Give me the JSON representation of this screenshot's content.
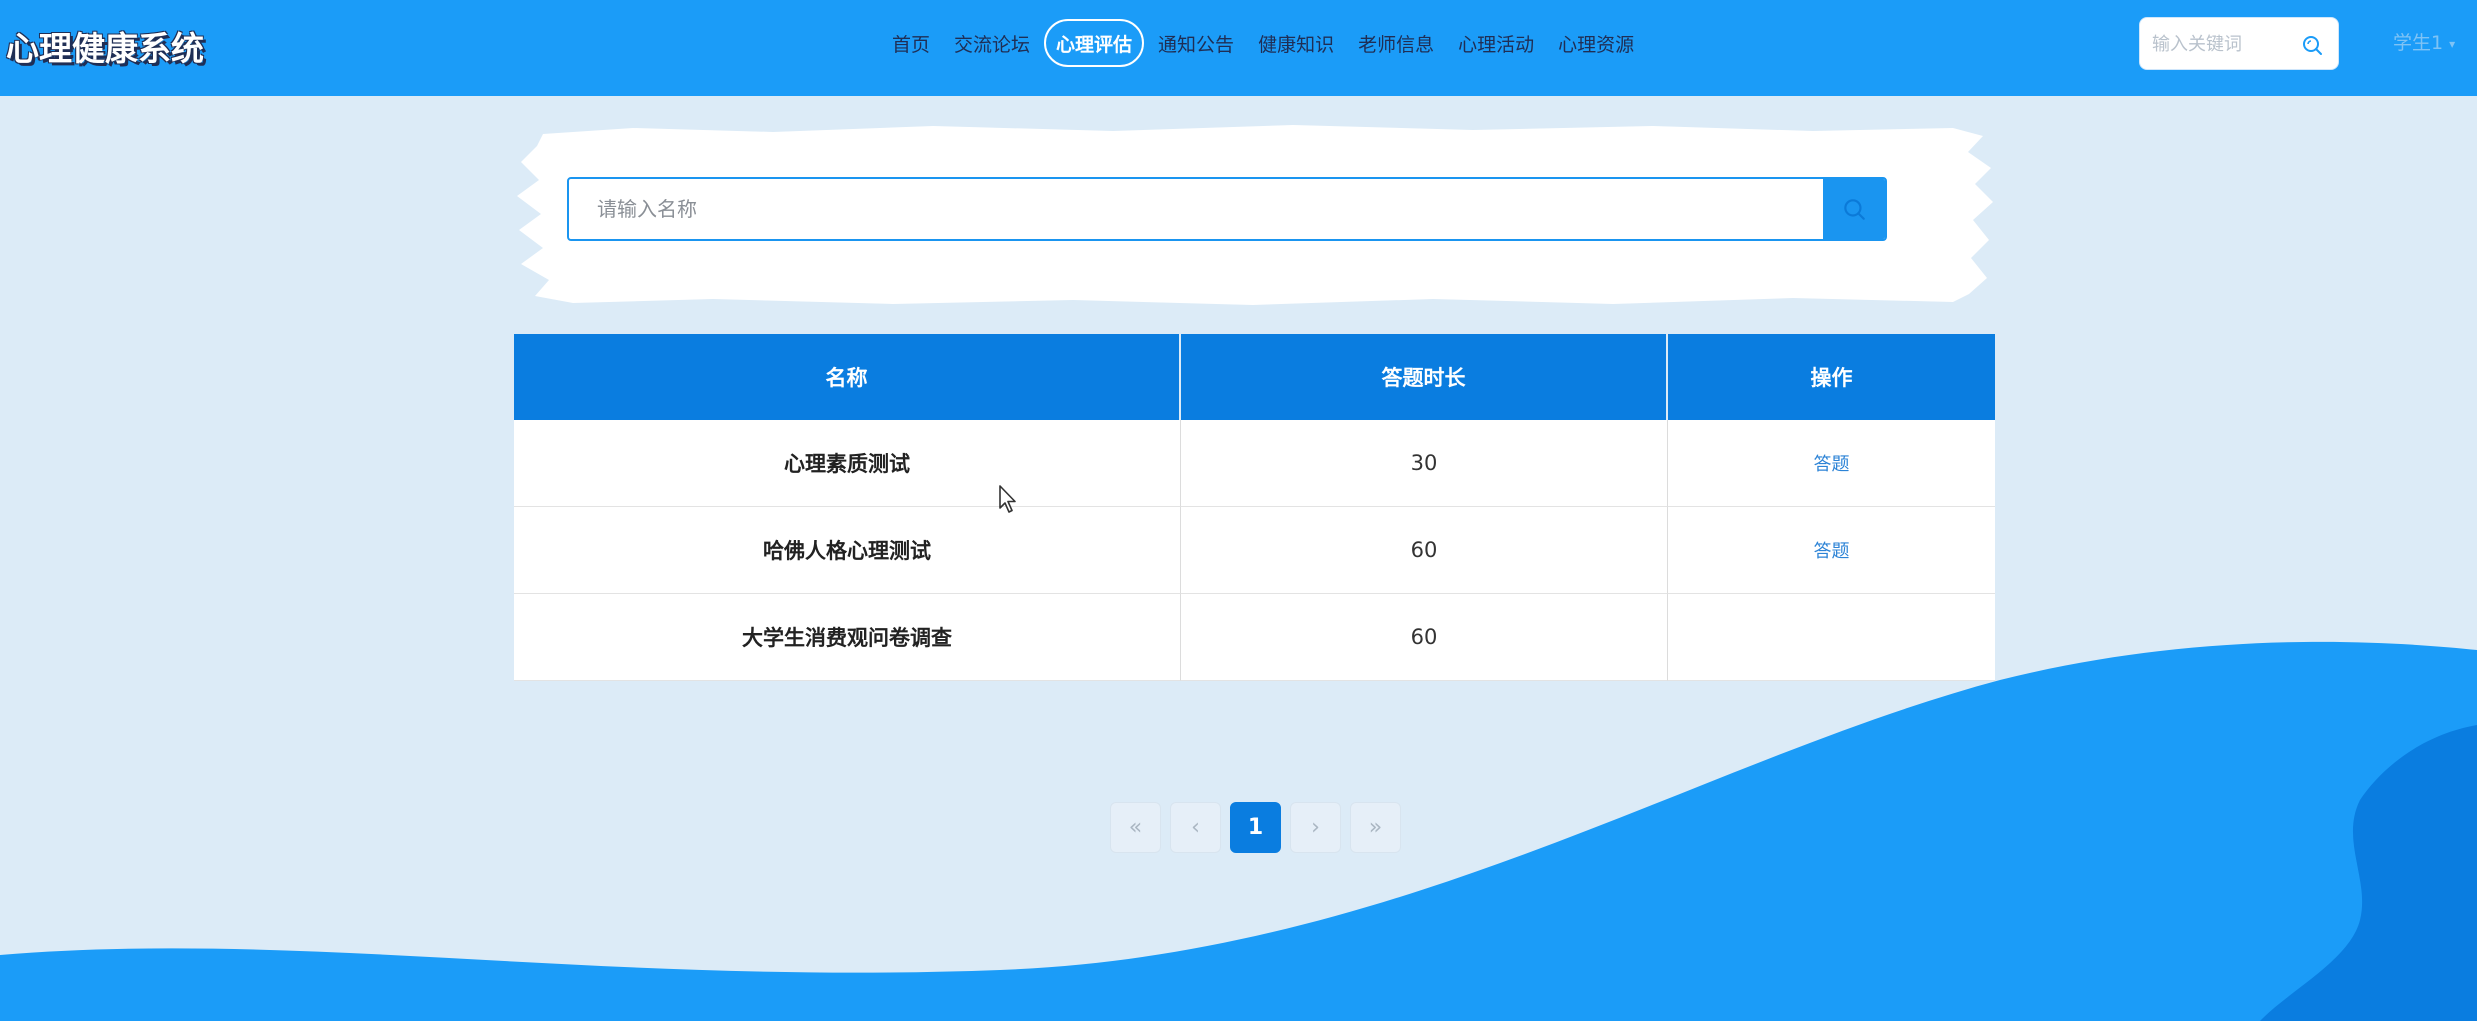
{
  "header": {
    "site_title": "心理健康系统",
    "nav": [
      {
        "label": "首页",
        "active": false
      },
      {
        "label": "交流论坛",
        "active": false
      },
      {
        "label": "心理评估",
        "active": true
      },
      {
        "label": "通知公告",
        "active": false
      },
      {
        "label": "健康知识",
        "active": false
      },
      {
        "label": "老师信息",
        "active": false
      },
      {
        "label": "心理活动",
        "active": false
      },
      {
        "label": "心理资源",
        "active": false
      }
    ],
    "search_placeholder": "输入关键词",
    "search_icon": "search-icon",
    "user_label": "学生1"
  },
  "search": {
    "placeholder": "请输入名称",
    "button_icon": "search-icon"
  },
  "table": {
    "columns": [
      "名称",
      "答题时长",
      "操作"
    ],
    "rows": [
      {
        "name": "心理素质测试",
        "duration": "30",
        "action": "答题"
      },
      {
        "name": "哈佛人格心理测试",
        "duration": "60",
        "action": "答题"
      },
      {
        "name": "大学生消费观问卷调查",
        "duration": "60",
        "action": ""
      }
    ]
  },
  "pagination": {
    "first": "«",
    "prev": "‹",
    "current": "1",
    "next": "›",
    "last": "»"
  },
  "colors": {
    "header_bg": "#1b9cf8",
    "accent": "#0a7de0",
    "page_bg": "#dcebf7",
    "wave": "#1b9cf8",
    "wave_dark": "#0a7de0"
  }
}
